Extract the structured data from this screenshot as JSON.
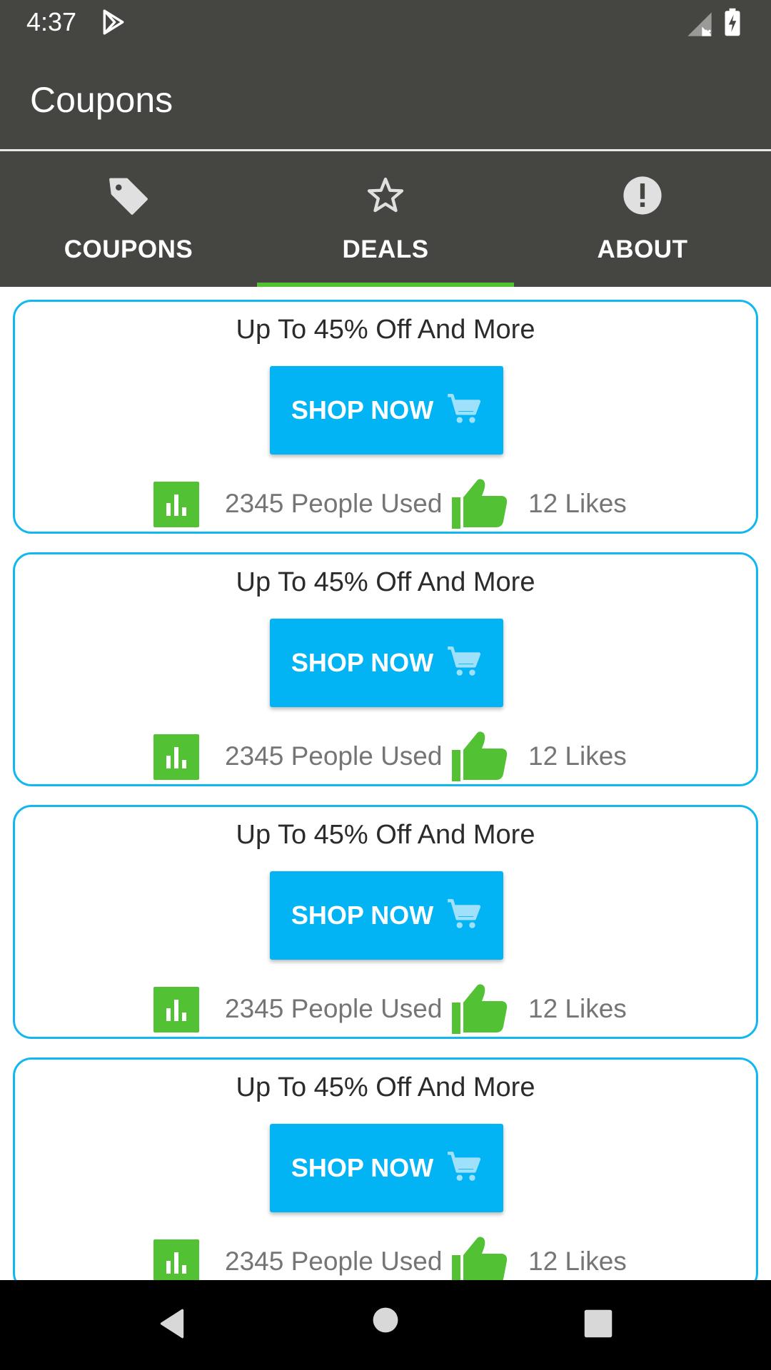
{
  "status_bar": {
    "time": "4:37"
  },
  "app_bar": {
    "title": "Coupons"
  },
  "tabs": [
    {
      "label": "COUPONS",
      "icon": "tag-icon",
      "selected": false
    },
    {
      "label": "DEALS",
      "icon": "star-icon",
      "selected": true
    },
    {
      "label": "ABOUT",
      "icon": "info-icon",
      "selected": false
    }
  ],
  "deals": [
    {
      "title": "Up To 45% Off And More",
      "button": "SHOP NOW",
      "used": "2345 People Used",
      "likes": "12 Likes"
    },
    {
      "title": "Up To 45% Off And More",
      "button": "SHOP NOW",
      "used": "2345 People Used",
      "likes": "12 Likes"
    },
    {
      "title": "Up To 45% Off And More",
      "button": "SHOP NOW",
      "used": "2345 People Used",
      "likes": "12 Likes"
    },
    {
      "title": "Up To 45% Off And More",
      "button": "SHOP NOW",
      "used": "2345 People Used",
      "likes": "12 Likes"
    }
  ],
  "colors": {
    "bar_background": "#454542",
    "accent_green": "#52c234",
    "accent_blue": "#03b4f4",
    "card_border": "#12b7ef"
  }
}
